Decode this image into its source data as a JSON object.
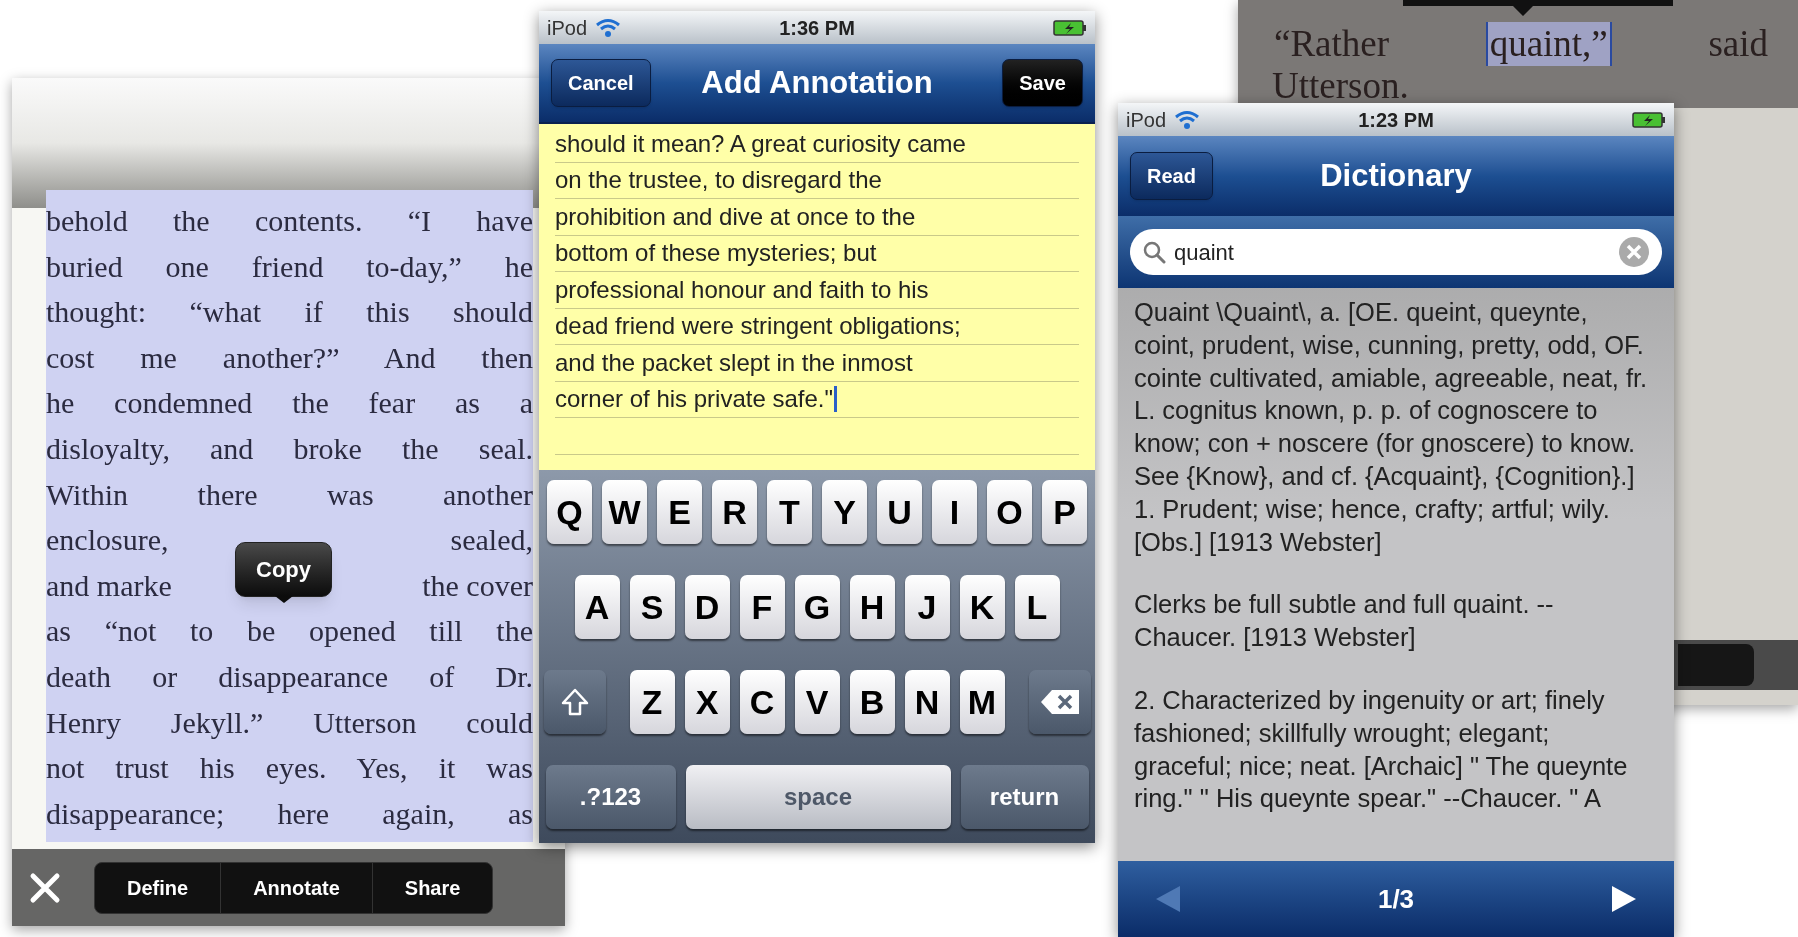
{
  "reader_left": {
    "lines": [
      [
        "behold the contents. “I have"
      ],
      [
        "buried one friend to-day,” he"
      ],
      [
        "thought: “what if this should"
      ],
      [
        "cost me another?” And then"
      ],
      [
        "he condemned the fear as a"
      ],
      [
        "disloyalty, and broke the seal."
      ],
      [
        "Within there was another"
      ],
      [
        "enclosure,",
        "sealed,"
      ],
      [
        "and marke",
        "the cover"
      ],
      [
        "as “not to be opened till the"
      ],
      [
        "death or disappearance of Dr."
      ],
      [
        "Henry Jekyll.” Utterson could"
      ],
      [
        "not trust his eyes. Yes, it was"
      ],
      [
        "disappearance; here again, as"
      ]
    ],
    "copy_popup": "Copy",
    "actions": [
      "Define",
      "Annotate",
      "Share"
    ]
  },
  "annotation_screen": {
    "status_bar": {
      "carrier": "iPod",
      "time": "1:36 PM"
    },
    "nav": {
      "left_button": "Cancel",
      "title": "Add Annotation",
      "right_button": "Save"
    },
    "note_lines": [
      "should it mean? A great curiosity came",
      "on the trustee, to disregard the",
      "prohibition and dive at once to the",
      "bottom of these mysteries; but",
      "professional honour and faith to his",
      "dead friend were stringent obligations;",
      "and the packet slept in the inmost",
      "corner of his private safe.\""
    ],
    "keyboard": [
      [
        {
          "kind": "letter",
          "label": "Q"
        },
        {
          "kind": "letter",
          "label": "W"
        },
        {
          "kind": "letter",
          "label": "E"
        },
        {
          "kind": "letter",
          "label": "R"
        },
        {
          "kind": "letter",
          "label": "T"
        },
        {
          "kind": "letter",
          "label": "Y"
        },
        {
          "kind": "letter",
          "label": "U"
        },
        {
          "kind": "letter",
          "label": "I"
        },
        {
          "kind": "letter",
          "label": "O"
        },
        {
          "kind": "letter",
          "label": "P"
        }
      ],
      [
        {
          "kind": "letter",
          "label": "A"
        },
        {
          "kind": "letter",
          "label": "S"
        },
        {
          "kind": "letter",
          "label": "D"
        },
        {
          "kind": "letter",
          "label": "F"
        },
        {
          "kind": "letter",
          "label": "G"
        },
        {
          "kind": "letter",
          "label": "H"
        },
        {
          "kind": "letter",
          "label": "J"
        },
        {
          "kind": "letter",
          "label": "K"
        },
        {
          "kind": "letter",
          "label": "L"
        }
      ],
      [
        {
          "kind": "shift"
        },
        {
          "kind": "letter",
          "label": "Z"
        },
        {
          "kind": "letter",
          "label": "X"
        },
        {
          "kind": "letter",
          "label": "C"
        },
        {
          "kind": "letter",
          "label": "V"
        },
        {
          "kind": "letter",
          "label": "B"
        },
        {
          "kind": "letter",
          "label": "N"
        },
        {
          "kind": "letter",
          "label": "M"
        },
        {
          "kind": "delete"
        }
      ],
      [
        {
          "kind": "mode",
          "label": ".?123"
        },
        {
          "kind": "space",
          "label": "space"
        },
        {
          "kind": "return",
          "label": "return"
        }
      ]
    ]
  },
  "reader_right": {
    "words": [
      {
        "text": "“Rather",
        "selected": false
      },
      {
        "text": "quaint,”",
        "selected": true
      },
      {
        "text": "said",
        "selected": false
      }
    ],
    "line_2": "Utterson."
  },
  "dictionary_screen": {
    "status_bar": {
      "carrier": "iPod",
      "time": "1:23 PM"
    },
    "nav": {
      "back_button": "Read",
      "title": "Dictionary"
    },
    "search": {
      "value": "quaint"
    },
    "paragraphs": [
      "Quaint \\Quaint\\, a. [OE. queint, queynte, coint, prudent, wise, cunning, pretty, odd, OF. cointe cultivated, amiable, agreeable, neat, fr. L. cognitus known, p. p. of cognoscere to know; con + noscere (for gnoscere) to know. See {Know}, and cf. {Acquaint}, {Cognition}.] 1. Prudent; wise; hence, crafty; artful; wily. [Obs.] [1913 Webster]",
      "Clerks be full subtle and full quaint. --Chaucer. [1913 Webster]",
      "2. Characterized by ingenuity or art; finely fashioned; skillfully wrought; elegant; graceful; nice; neat. [Archaic] \" The queynte ring.\" \" His queynte spear.\" --Chaucer. \" A"
    ],
    "pager": "1/3"
  }
}
